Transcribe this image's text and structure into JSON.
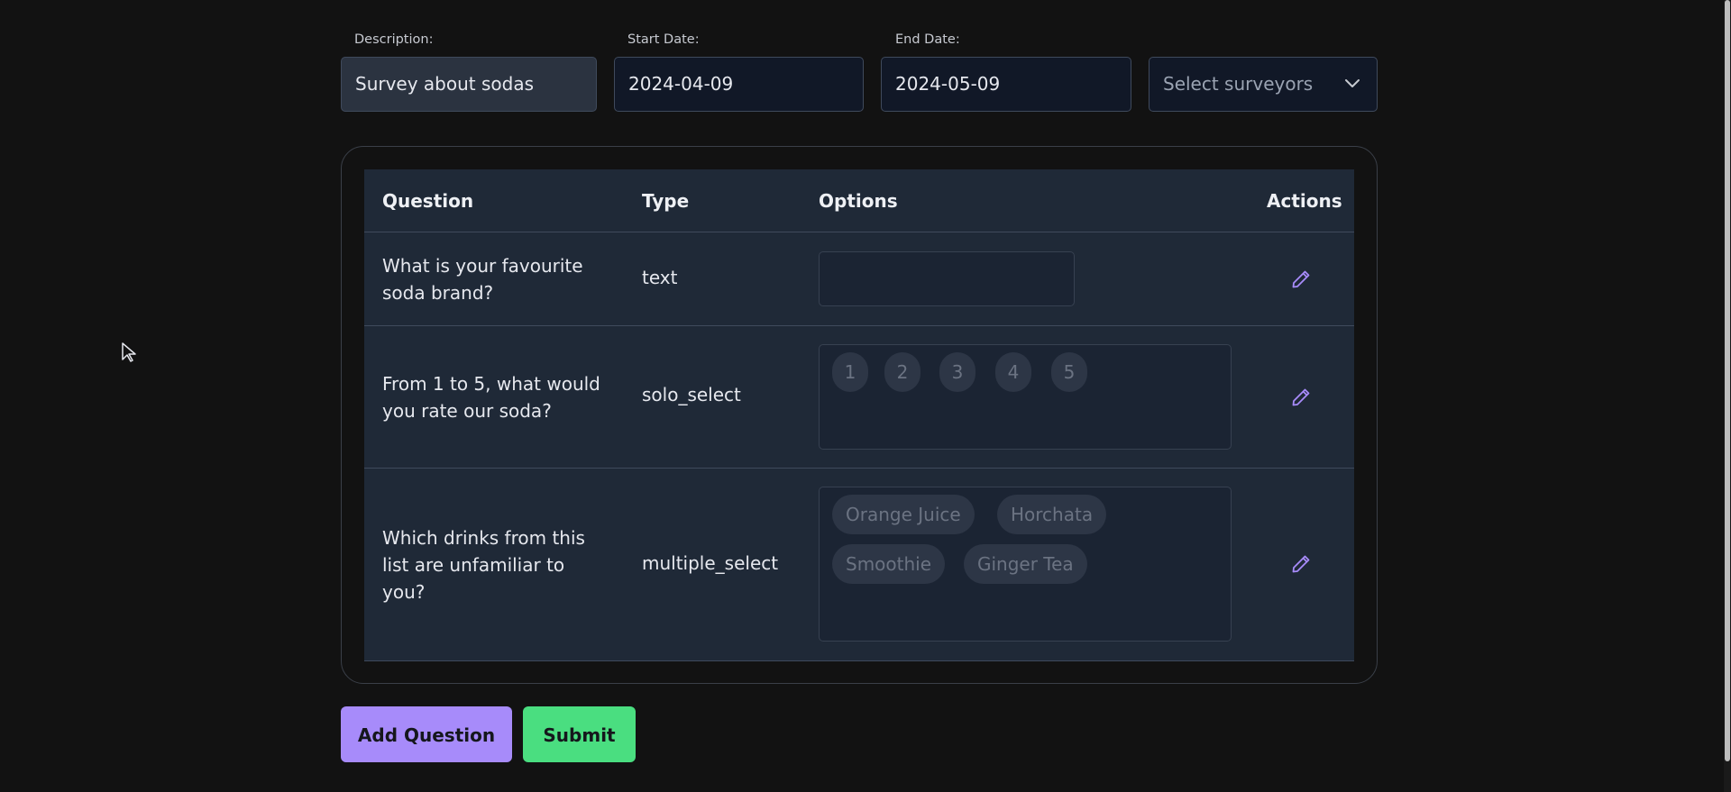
{
  "form": {
    "description_label": "Description:",
    "description_value": "Survey about sodas",
    "start_label": "Start Date:",
    "start_value": "2024-04-09",
    "end_label": "End Date:",
    "end_value": "2024-05-09",
    "surveyors_placeholder": "Select surveyors"
  },
  "table": {
    "headers": {
      "question": "Question",
      "type": "Type",
      "options": "Options",
      "actions": "Actions"
    },
    "rows": [
      {
        "question": "What is your favourite soda brand?",
        "type": "text",
        "options": []
      },
      {
        "question": "From 1 to 5, what would you rate our soda?",
        "type": "solo_select",
        "options": [
          "1",
          "2",
          "3",
          "4",
          "5"
        ]
      },
      {
        "question": "Which drinks from this list are unfamiliar to you?",
        "type": "multiple_select",
        "options": [
          "Orange Juice",
          "Horchata",
          "Smoothie",
          "Ginger Tea"
        ]
      }
    ]
  },
  "buttons": {
    "add_question": "Add Question",
    "submit": "Submit"
  },
  "icons": {
    "edit": "pencil-icon",
    "dropdown": "chevron-down-icon",
    "cursor": "mouse-pointer-icon"
  },
  "colors": {
    "background": "#121212",
    "accent_purple": "#a78bfa",
    "accent_green": "#4ade80",
    "table_bg": "#1f2937"
  }
}
